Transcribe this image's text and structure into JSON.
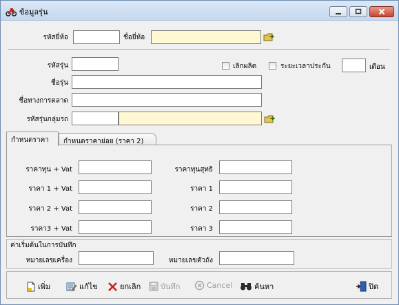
{
  "window": {
    "title": "ข้อมูลรุ่น"
  },
  "header": {
    "brand_code_label": "รหัสยี่ห้อ",
    "brand_code_value": "",
    "brand_name_label": "ชื่อยี่ห้อ",
    "brand_name_value": ""
  },
  "model": {
    "code_label": "รหัสรุ่น",
    "code_value": "",
    "discontinued_label": "เลิกผลิต",
    "warranty_label": "ระยะเวลาประกัน",
    "warranty_value": "",
    "month_label": "เดือน",
    "name_label": "ชื่อรุ่น",
    "name_value": "",
    "marketing_name_label": "ชื่อทางการตลาด",
    "marketing_name_value": "",
    "group_code_label": "รหัสรุ่นกลุ่มรถ",
    "group_code_value": "",
    "group_name_value": ""
  },
  "tabs": [
    {
      "label": "กำหนดราคา"
    },
    {
      "label": "กำหนดราคาย่อย (ราคา 2)"
    }
  ],
  "pricing": {
    "cost_vat_label": "ราคาทุน + Vat",
    "net_cost_label": "ราคาทุนสุทธิ",
    "price1_vat_label": "ราคา 1 + Vat",
    "price1_label": "ราคา 1",
    "price2_vat_label": "ราคา 2 + Vat",
    "price2_label": "ราคา 2",
    "price3_vat_label": "ราคา3 + Vat",
    "price3_label": "ราคา 3"
  },
  "defaults": {
    "group_label": "ค่าเริ่มต้นในการบันทึก",
    "machine_no_label": "หมายเลขเครื่อง",
    "chassis_no_label": "หมายเลขตัวถัง"
  },
  "toolbar": {
    "add_label": "เพิ่ม",
    "edit_label": "แก้ไข",
    "cancel_edit_label": "ยกเลิก",
    "save_label": "บันทึก",
    "cancel_label": "Cancel",
    "search_label": "ค้นหา",
    "close_label": "ปิด"
  }
}
